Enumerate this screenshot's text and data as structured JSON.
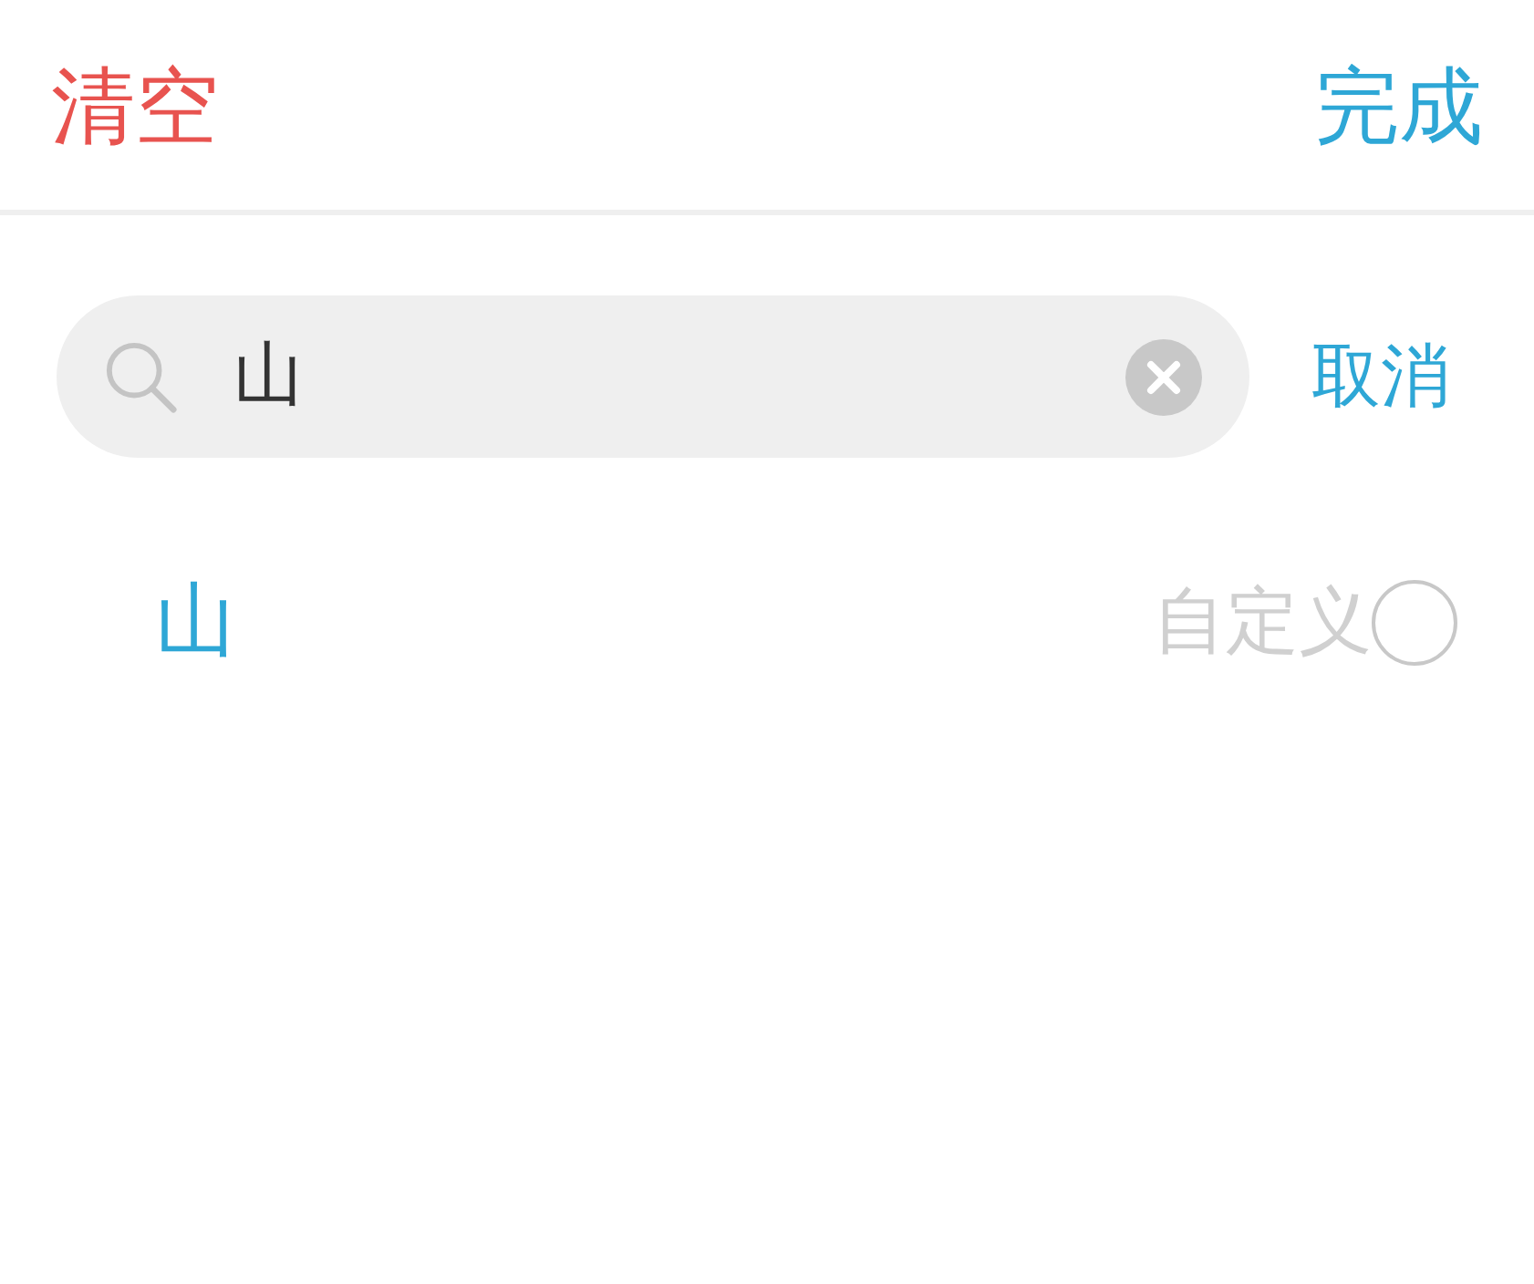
{
  "header": {
    "clear_label": "清空",
    "done_label": "完成"
  },
  "search": {
    "value": "山",
    "cancel_label": "取消"
  },
  "results": [
    {
      "text": "山",
      "tag": "自定义",
      "selected": false
    }
  ]
}
